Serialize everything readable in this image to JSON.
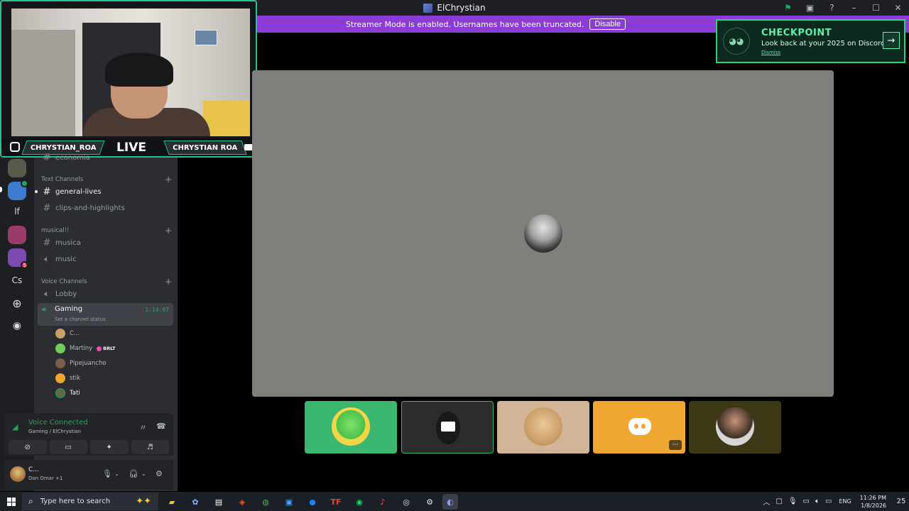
{
  "window": {
    "title": "ElChrystian"
  },
  "streamer_banner": {
    "text": "Streamer Mode is enabled. Usernames have been truncated.",
    "button": "Disable"
  },
  "checkpoint": {
    "title": "CHECKPOINT",
    "subtitle": "Look back at your 2025 on Discord",
    "dismiss": "Dismiss"
  },
  "webcam": {
    "left_tag": "CHRYSTIAN_ROA",
    "center_label": "LIVE",
    "right_tag": "CHRYSTIAN ROA"
  },
  "servers": {
    "item_lf": "lf",
    "item_cs": "Cs",
    "badge": "5"
  },
  "channels": {
    "top_channel": "economia",
    "text_category": "Text Channels",
    "text_items": [
      "general-lives",
      "clips-and-highlights"
    ],
    "music_category": "musical!!",
    "music_text": "musica",
    "music_voice": "music",
    "voice_category": "Voice Channels",
    "lobby": "Lobby",
    "gaming": {
      "name": "Gaming",
      "status": "Set a channel status",
      "timer": "1:14:07"
    },
    "members": [
      "C...",
      "Martiny",
      "Pipejuancho",
      "stik",
      "Tati"
    ],
    "member_tag": "BRLT"
  },
  "voice_panel": {
    "title": "Voice Connected",
    "subtitle": "Gaming / ElChrystian"
  },
  "user_panel": {
    "name": "C...",
    "activity": "Don Omar +1"
  },
  "taskbar": {
    "search_placeholder": "Type here to search",
    "language": "ENG",
    "time": "11:26 PM",
    "date": "1/8/2026",
    "notification_count": "25"
  },
  "colors": {
    "accent_green": "#23a55a",
    "streamer_purple": "#8c3cd6",
    "checkpoint_green": "#5ff0a4"
  }
}
